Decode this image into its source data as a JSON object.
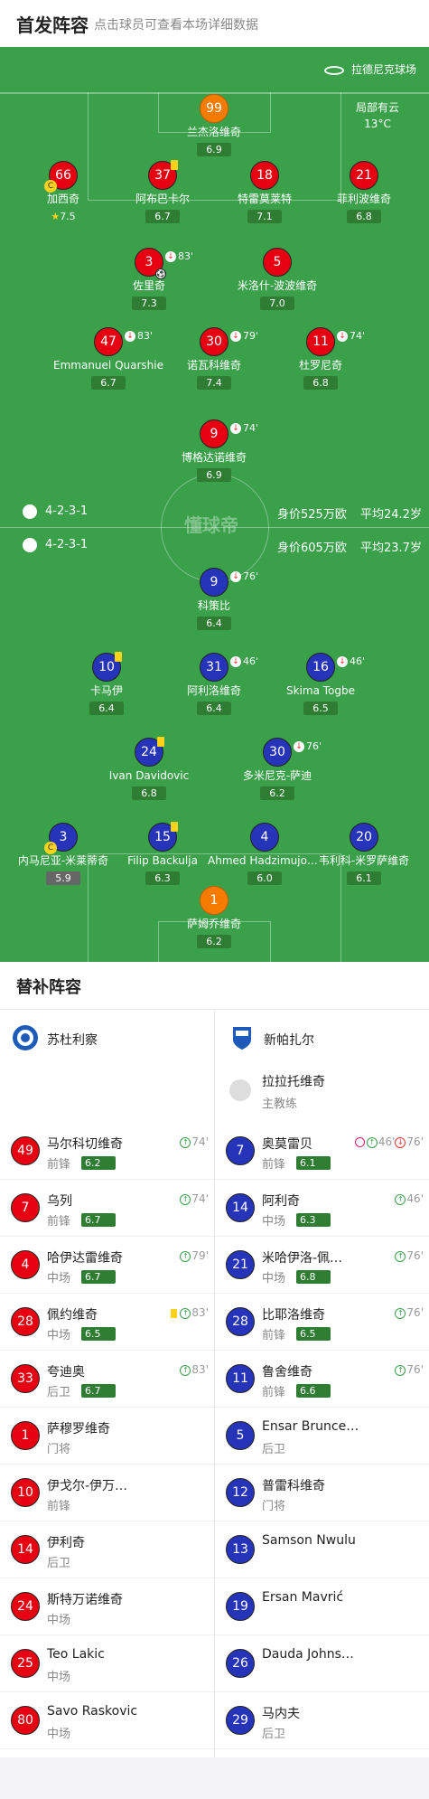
{
  "header": {
    "title": "首发阵容",
    "subtitle": "点击球员可查看本场详细数据"
  },
  "field": {
    "stadium": "拉德尼克球场",
    "weather": "局部有云",
    "temperature": "13°C",
    "watermark": "懂球帝",
    "home": {
      "formation": "4-2-3-1",
      "value": "身价525万欧",
      "age": "平均24.2岁"
    },
    "away": {
      "formation": "4-2-3-1",
      "value": "身价605万欧",
      "age": "平均23.7岁"
    }
  },
  "home_players": [
    {
      "num": "99",
      "name": "兰杰洛维奇",
      "rating": "6.9",
      "gk": true
    },
    {
      "num": "66",
      "name": "加西奇",
      "rating": "7.5",
      "captain": true,
      "star": true
    },
    {
      "num": "37",
      "name": "阿布巴卡尔",
      "rating": "6.7",
      "yellow": true
    },
    {
      "num": "18",
      "name": "特雷莫莱特",
      "rating": "7.1"
    },
    {
      "num": "21",
      "name": "菲利波维奇",
      "rating": "6.8"
    },
    {
      "num": "3",
      "name": "佐里奇",
      "rating": "7.3",
      "sub": "83'",
      "goal": true
    },
    {
      "num": "5",
      "name": "米洛什-波波维奇",
      "rating": "7.0"
    },
    {
      "num": "47",
      "name": "Emmanuel Quarshie",
      "rating": "6.7",
      "sub": "83'"
    },
    {
      "num": "30",
      "name": "诺瓦科维奇",
      "rating": "7.4",
      "sub": "79'"
    },
    {
      "num": "11",
      "name": "杜罗尼奇",
      "rating": "6.8",
      "sub": "74'"
    },
    {
      "num": "9",
      "name": "博格达诺维奇",
      "rating": "6.9",
      "sub": "74'"
    }
  ],
  "away_players": [
    {
      "num": "9",
      "name": "科策比",
      "rating": "6.4",
      "sub": "76'"
    },
    {
      "num": "10",
      "name": "卡马伊",
      "rating": "6.4",
      "yellow": true
    },
    {
      "num": "31",
      "name": "阿利洛维奇",
      "rating": "6.4",
      "sub": "46'"
    },
    {
      "num": "16",
      "name": "Skima Togbe",
      "rating": "6.5",
      "sub": "46'"
    },
    {
      "num": "24",
      "name": "Ivan Davidovic",
      "rating": "6.8",
      "yellow": true
    },
    {
      "num": "30",
      "name": "多米尼克-萨迪",
      "rating": "6.2",
      "sub": "76'"
    },
    {
      "num": "3",
      "name": "内马尼亚-米莱蒂奇",
      "rating": "5.9",
      "captain": true,
      "grey": true
    },
    {
      "num": "15",
      "name": "Filip Backulja",
      "rating": "6.3",
      "yellow": true
    },
    {
      "num": "4",
      "name": "Ahmed Hadzimujovic",
      "rating": "6.0"
    },
    {
      "num": "20",
      "name": "韦利科-米罗萨维奇",
      "rating": "6.1"
    },
    {
      "num": "1",
      "name": "萨姆乔维奇",
      "rating": "6.2",
      "gk": true
    }
  ],
  "bench": {
    "title": "替补阵容",
    "home_team": "苏杜利察",
    "away_team": "新帕扎尔",
    "coach": {
      "name": "拉拉托维奇",
      "role": "主教练"
    },
    "home_subs": [
      {
        "num": "49",
        "name": "马尔科切维奇",
        "pos": "前锋",
        "rating": "6.2",
        "ev": "74'",
        "in": true
      },
      {
        "num": "7",
        "name": "乌列",
        "pos": "前锋",
        "rating": "6.7",
        "ev": "74'",
        "in": true
      },
      {
        "num": "4",
        "name": "哈伊达雷维奇",
        "pos": "中场",
        "rating": "6.7",
        "ev": "79'",
        "in": true
      },
      {
        "num": "28",
        "name": "佩约维奇",
        "pos": "中场",
        "rating": "6.5",
        "ev": "83'",
        "in": true,
        "yellow": true
      },
      {
        "num": "33",
        "name": "夸迪奥",
        "pos": "后卫",
        "rating": "6.7",
        "ev": "83'",
        "in": true
      },
      {
        "num": "1",
        "name": "萨穆罗维奇",
        "pos": "门将"
      },
      {
        "num": "10",
        "name": "伊戈尔-伊万…",
        "pos": "前锋"
      },
      {
        "num": "14",
        "name": "伊利奇",
        "pos": "后卫"
      },
      {
        "num": "24",
        "name": "斯特万诺维奇",
        "pos": "中场"
      },
      {
        "num": "25",
        "name": "Teo Lakic",
        "pos": "中场"
      },
      {
        "num": "80",
        "name": "Savo Raskovic",
        "pos": "中场"
      }
    ],
    "away_subs": [
      {
        "num": "7",
        "name": "奥莫雷贝",
        "pos": "前锋",
        "rating": "6.1",
        "ev": "46'",
        "ev2": "76'",
        "in": true,
        "ball": true
      },
      {
        "num": "14",
        "name": "阿利奇",
        "pos": "中场",
        "rating": "6.3",
        "ev": "46'",
        "in": true
      },
      {
        "num": "21",
        "name": "米哈伊洛-佩…",
        "pos": "中场",
        "rating": "6.8",
        "ev": "76'",
        "in": true
      },
      {
        "num": "28",
        "name": "比耶洛维奇",
        "pos": "前锋",
        "rating": "6.5",
        "ev": "76'",
        "in": true
      },
      {
        "num": "11",
        "name": "鲁舍维奇",
        "pos": "前锋",
        "rating": "6.6",
        "ev": "76'",
        "in": true
      },
      {
        "num": "5",
        "name": "Ensar Brunce…",
        "pos": "后卫"
      },
      {
        "num": "12",
        "name": "普雷科维奇",
        "pos": "门将"
      },
      {
        "num": "13",
        "name": "Samson Nwulu",
        "pos": ""
      },
      {
        "num": "19",
        "name": "Ersan Mavrić",
        "pos": ""
      },
      {
        "num": "26",
        "name": "Dauda Johns…",
        "pos": ""
      },
      {
        "num": "29",
        "name": "马内夫",
        "pos": "后卫"
      }
    ]
  }
}
